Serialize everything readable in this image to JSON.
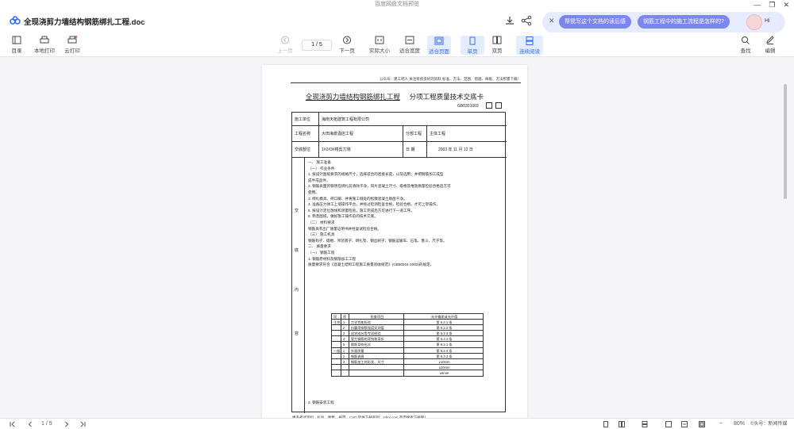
{
  "app": {
    "window_title": "百度网盘文档预览",
    "doc_title": "全现浇剪力墙结构钢筋绑扎工程.doc"
  },
  "ai_assistant": {
    "suggestion_1": "帮我写这个文档的读后感",
    "suggestion_2": "钢筋工程中的施工流程是怎样的?",
    "greeting": "Hi"
  },
  "toolbar": {
    "outline": "目录",
    "local_print": "本地打印",
    "cloud_print": "云打印",
    "prev_page": "上一页",
    "page_indicator": "1 / 5",
    "next_page": "下一页",
    "actual_size": "实际大小",
    "fit_width": "适合宽度",
    "fit_page": "适合页面",
    "single_page": "单页",
    "double_page": "双页",
    "continuous": "连续阅读",
    "find": "查找",
    "edit": "编辑"
  },
  "document": {
    "notice": "公众号：建工吧人 关注有很多好的资料   标准、方法、范围、措施、样板、方法积累下载！",
    "title_underlined": "全现浇剪力墙结构钢筋绑扎工程",
    "title_rest": "分项工程质量技术交底卡",
    "code": "GB0301003",
    "contractor_label": "施工单位",
    "contractor_value": "海南天拓建筑工程有限公司",
    "project_label": "工程名称",
    "project_value": "大田海景酒店工程",
    "subproject_label": "分部工程",
    "subproject_value": "主体工程",
    "location_label": "交底部位",
    "location_value": "1#2#3#楼剪力墙",
    "date_label": "日    期",
    "date_value": "2003    年  11  月  12  日",
    "side_labels": [
      "交",
      "底",
      "内",
      "容"
    ],
    "content_lines": [
      "一、  施工准备",
      "（一）  作业条件",
      "1.     按设计图纸要求的规格尺寸，选择适合的连接长度，以及选用；并把钢筋加工成型",
      "       成半成品件。",
      "2.     钢筋表面的铁锈在绑扎前清除干净，同片混凝土尺寸、级格及堆放质量检验合格后方可",
      "       使用。",
      "3.     绑扎模具、砖口脚、并将施工缝处的松散混凝土剔凿干净。",
      "4.     准备压力弹工上墙操作平台，并经过检测检查合格，检验合格。才可上架操作。",
      "5.     按设计定位放线和测量检验，施工完成后方可进行下一道工序。",
      "6.     熟悉图纸，做好施工操作前的技术交底。",
      "（二）  材料要求",
      "   钢筋具有出厂质量证明书并经复试检验合格。",
      "（三）  施工机具",
      "   钢筋钩子、撬棍、吊装扳子、绑扎架、钢丝刷子、钢筋运输车、石笔、墨斗、尺子等。",
      "二、  质量要求",
      "（一）  钢筋工程",
      "1.     钢筋原材料及钢筋加工工程",
      "       质量要求符合《混凝土结构工程施工质量验收规范》(GB50204-2002)的规定。"
    ],
    "last_line": "2.     钢筋安装工程",
    "quality_table": {
      "headers": [
        "项",
        "序",
        "检查项目",
        "允许偏差或允许值"
      ],
      "main_group": "主控项目",
      "general_group": "一般项目",
      "rows": [
        [
          "1",
          "力学性能检验",
          "第 5.2.1 条"
        ],
        [
          "2",
          "抗震用钢筋强度实测值",
          "第 5.2.2 条"
        ],
        [
          "3",
          "化学成分等专项检验",
          "第 5.2.3 条"
        ],
        [
          "4",
          "受力钢筋的弯钩和弯折",
          "第 5.3.1 条"
        ],
        [
          "5",
          "箍筋弯钩形式",
          "第 5.3.1 条"
        ],
        [
          "1",
          "外观质量",
          "第 5.2.4 条"
        ],
        [
          "2",
          "钢筋调直",
          "第 5.3.3 条"
        ],
        [
          "3",
          "钢筋加工的形状、尺寸",
          "±10mm"
        ],
        [
          "",
          "",
          "±20mm"
        ],
        [
          "",
          "",
          "±5mm"
        ]
      ]
    },
    "footer_text": "更多考试资料、标准、图集、规范、CAD 软件下载就到：adjpl.com 百度搜索下载吧！"
  },
  "statusbar": {
    "page_indicator": "1 / 5",
    "zoom": "80%",
    "watermark": "©头号：新闻传媒"
  }
}
